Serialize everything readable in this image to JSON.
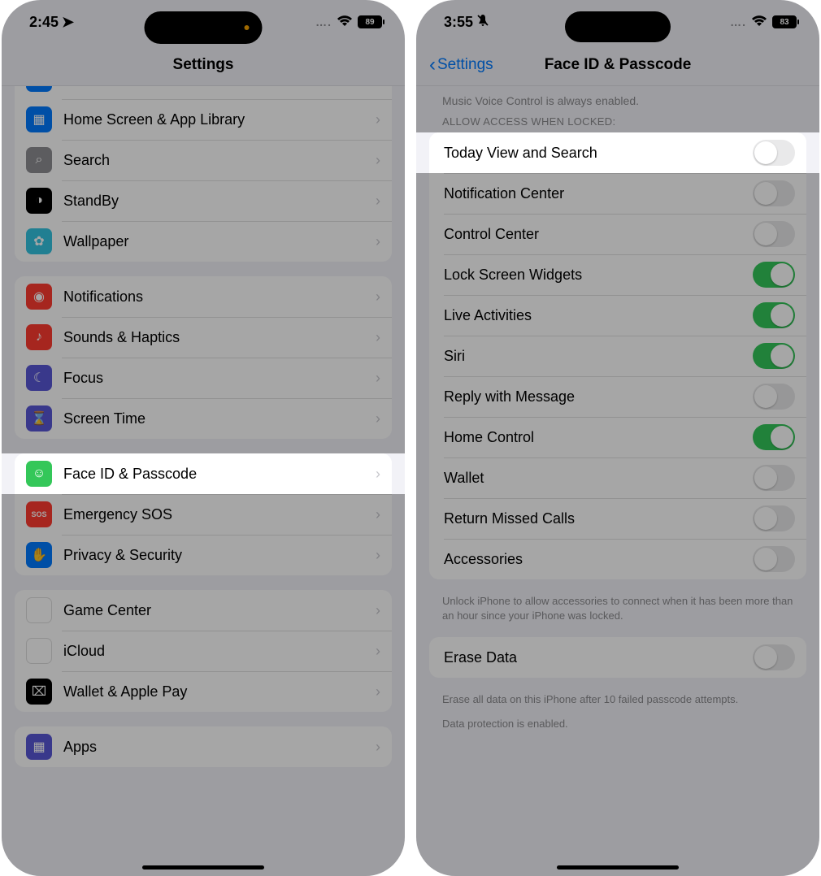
{
  "left": {
    "status": {
      "time": "2:45",
      "battery": "89"
    },
    "title": "Settings",
    "groups": [
      {
        "rows": [
          {
            "label": "Home Screen & App Library",
            "icon": "home-screen-icon",
            "bg": "bg-blue",
            "glyph": "▦"
          },
          {
            "label": "Search",
            "icon": "search-icon",
            "bg": "bg-gray",
            "glyph": "⌕"
          },
          {
            "label": "StandBy",
            "icon": "standby-icon",
            "bg": "bg-black",
            "glyph": "◑"
          },
          {
            "label": "Wallpaper",
            "icon": "wallpaper-icon",
            "bg": "bg-teal",
            "glyph": "✿"
          }
        ]
      },
      {
        "rows": [
          {
            "label": "Notifications",
            "icon": "notifications-icon",
            "bg": "bg-red",
            "glyph": "◉"
          },
          {
            "label": "Sounds & Haptics",
            "icon": "sounds-icon",
            "bg": "bg-redb",
            "glyph": "♪"
          },
          {
            "label": "Focus",
            "icon": "focus-icon",
            "bg": "bg-purple",
            "glyph": "☾"
          },
          {
            "label": "Screen Time",
            "icon": "screen-time-icon",
            "bg": "bg-purple",
            "glyph": "⌛"
          }
        ]
      },
      {
        "rows": [
          {
            "label": "Face ID & Passcode",
            "icon": "faceid-icon",
            "bg": "bg-green",
            "glyph": "☺",
            "highlighted": true
          },
          {
            "label": "Emergency SOS",
            "icon": "sos-icon",
            "bg": "bg-red",
            "glyph": "SOS",
            "small": true
          },
          {
            "label": "Privacy & Security",
            "icon": "privacy-icon",
            "bg": "bg-blue",
            "glyph": "✋"
          }
        ]
      },
      {
        "rows": [
          {
            "label": "Game Center",
            "icon": "game-center-icon",
            "bg": "bg-white",
            "glyph": "✦"
          },
          {
            "label": "iCloud",
            "icon": "icloud-icon",
            "bg": "bg-white",
            "glyph": "☁"
          },
          {
            "label": "Wallet & Apple Pay",
            "icon": "wallet-icon",
            "bg": "bg-black",
            "glyph": "⌧"
          }
        ]
      },
      {
        "rows": [
          {
            "label": "Apps",
            "icon": "apps-icon",
            "bg": "bg-purple",
            "glyph": "▦"
          }
        ]
      }
    ]
  },
  "right": {
    "status": {
      "time": "3:55",
      "battery": "83"
    },
    "back": "Settings",
    "title": "Face ID & Passcode",
    "top_note": "Music Voice Control is always enabled.",
    "section_header": "ALLOW ACCESS WHEN LOCKED:",
    "toggles": [
      {
        "label": "Today View and Search",
        "on": false,
        "highlighted": true
      },
      {
        "label": "Notification Center",
        "on": false
      },
      {
        "label": "Control Center",
        "on": false
      },
      {
        "label": "Lock Screen Widgets",
        "on": true
      },
      {
        "label": "Live Activities",
        "on": true
      },
      {
        "label": "Siri",
        "on": true
      },
      {
        "label": "Reply with Message",
        "on": false
      },
      {
        "label": "Home Control",
        "on": true
      },
      {
        "label": "Wallet",
        "on": false
      },
      {
        "label": "Return Missed Calls",
        "on": false
      },
      {
        "label": "Accessories",
        "on": false
      }
    ],
    "accessories_footer": "Unlock iPhone to allow accessories to connect when it has been more than an hour since your iPhone was locked.",
    "erase": {
      "label": "Erase Data",
      "on": false
    },
    "erase_footer": "Erase all data on this iPhone after 10 failed passcode attempts.",
    "protection_note": "Data protection is enabled."
  }
}
